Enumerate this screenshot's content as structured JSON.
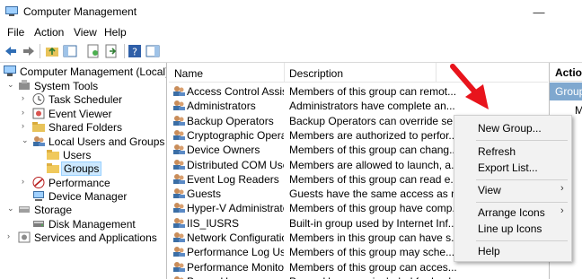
{
  "window": {
    "title": "Computer Management",
    "controls": {
      "minimize": "—",
      "close": "✕"
    }
  },
  "menubar": {
    "items": [
      "File",
      "Action",
      "View",
      "Help"
    ]
  },
  "tree": {
    "items": [
      {
        "label": "Computer Management (Local)",
        "expander": "",
        "icon": "computer-management-icon"
      },
      {
        "label": "System Tools",
        "expander": "⌄",
        "icon": "system-tools-icon"
      },
      {
        "label": "Task Scheduler",
        "expander": "›",
        "icon": "clock-icon"
      },
      {
        "label": "Event Viewer",
        "expander": "›",
        "icon": "event-viewer-icon"
      },
      {
        "label": "Shared Folders",
        "expander": "›",
        "icon": "shared-folder-icon"
      },
      {
        "label": "Local Users and Groups",
        "expander": "⌄",
        "icon": "users-groups-icon"
      },
      {
        "label": "Users",
        "expander": "",
        "icon": "folder-icon"
      },
      {
        "label": "Groups",
        "expander": "",
        "icon": "folder-icon",
        "selected": true
      },
      {
        "label": "Performance",
        "expander": "›",
        "icon": "performance-icon"
      },
      {
        "label": "Device Manager",
        "expander": "",
        "icon": "device-manager-icon"
      },
      {
        "label": "Storage",
        "expander": "⌄",
        "icon": "storage-icon"
      },
      {
        "label": "Disk Management",
        "expander": "",
        "icon": "disk-icon"
      },
      {
        "label": "Services and Applications",
        "expander": "›",
        "icon": "services-icon"
      }
    ]
  },
  "list": {
    "columns": [
      "Name",
      "Description"
    ],
    "rows": [
      {
        "name": "Access Control Assist...",
        "desc": "Members of this group can remot..."
      },
      {
        "name": "Administrators",
        "desc": "Administrators have complete an..."
      },
      {
        "name": "Backup Operators",
        "desc": "Backup Operators can override se..."
      },
      {
        "name": "Cryptographic Operat...",
        "desc": "Members are authorized to perfor..."
      },
      {
        "name": "Device Owners",
        "desc": "Members of this group can chang..."
      },
      {
        "name": "Distributed COM Users",
        "desc": "Members are allowed to launch, a..."
      },
      {
        "name": "Event Log Readers",
        "desc": "Members of this group can read e..."
      },
      {
        "name": "Guests",
        "desc": "Guests have the same access as m..."
      },
      {
        "name": "Hyper-V Administrators",
        "desc": "Members of this group have comp..."
      },
      {
        "name": "IIS_IUSRS",
        "desc": "Built-in group used by Internet Inf..."
      },
      {
        "name": "Network Configuratio...",
        "desc": "Members in this group can have s..."
      },
      {
        "name": "Performance Log Users",
        "desc": "Members of this group may sche..."
      },
      {
        "name": "Performance Monitor ...",
        "desc": "Members of this group can acces..."
      },
      {
        "name": "Power Users",
        "desc": "Power Users are included for back..."
      }
    ]
  },
  "actions": {
    "header": "Action",
    "group": "Group",
    "more": "M"
  },
  "context_menu": {
    "items": [
      {
        "label": "New Group...",
        "submenu": false
      },
      {
        "label": "Refresh",
        "submenu": false
      },
      {
        "label": "Export List...",
        "submenu": false
      },
      {
        "label": "View",
        "submenu": true
      },
      {
        "label": "Arrange Icons",
        "submenu": true
      },
      {
        "label": "Line up Icons",
        "submenu": false
      },
      {
        "label": "Help",
        "submenu": false
      }
    ],
    "submenu_glyph": "›"
  },
  "colors": {
    "annotation": "#e8141c",
    "selection": "#cce8ff",
    "actions_highlight": "#7fa8cf"
  }
}
